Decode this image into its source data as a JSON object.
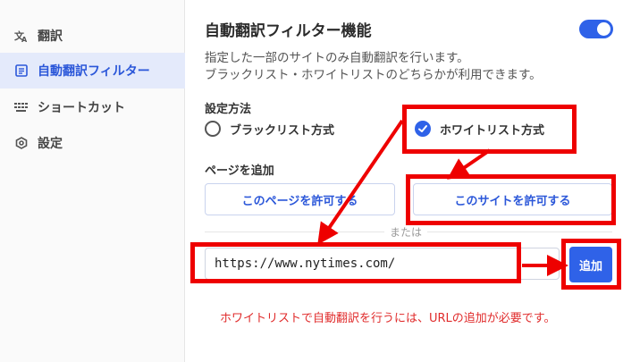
{
  "sidebar": {
    "items": [
      {
        "label": "翻訳",
        "icon": "translate-icon",
        "active": false
      },
      {
        "label": "自動翻訳フィルター",
        "icon": "list-icon",
        "active": true
      },
      {
        "label": "ショートカット",
        "icon": "keyboard-icon",
        "active": false
      },
      {
        "label": "設定",
        "icon": "settings-icon",
        "active": false
      }
    ]
  },
  "main": {
    "title": "自動翻訳フィルター機能",
    "toggle_on": true,
    "description": [
      "指定した一部のサイトのみ自動翻訳を行います。",
      "ブラックリスト・ホワイトリストのどちらかが利用できます。"
    ],
    "mode_label": "設定方法",
    "modes": [
      {
        "label": "ブラックリスト方式",
        "selected": false
      },
      {
        "label": "ホワイトリスト方式",
        "selected": true
      }
    ],
    "page_label": "ページを追加",
    "allow_page_button": "このページを許可する",
    "allow_site_button": "このサイトを許可する",
    "or_text": "または",
    "url_value": "https://www.nytimes.com/",
    "add_button": "追加",
    "note": "ホワイトリストで自動翻訳を行うには、URLの追加が必要です。"
  },
  "colors": {
    "accent": "#2f62e8",
    "annotation": "#ee0000",
    "sidebar_active_bg": "#e4eafb"
  }
}
